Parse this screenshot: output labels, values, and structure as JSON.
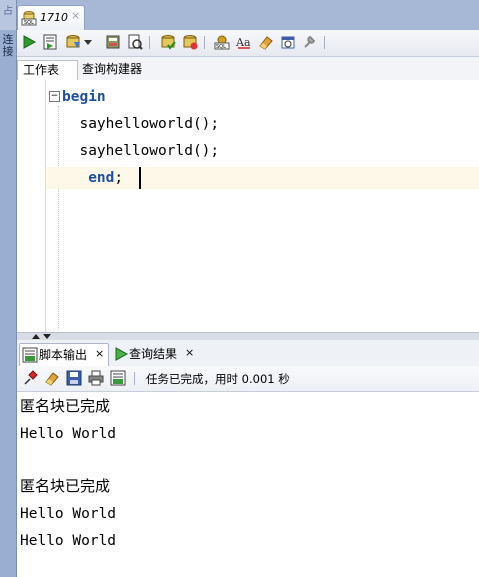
{
  "dock": {
    "top_label": "占",
    "vertical_label": "连接"
  },
  "editor_tab": {
    "title": "1710",
    "close": "×"
  },
  "sub_tabs": [
    {
      "label": "工作表"
    },
    {
      "label": "查询构建器"
    }
  ],
  "code": {
    "lines": [
      {
        "indent": "",
        "keyword": "begin",
        "text": ""
      },
      {
        "indent": "  ",
        "keyword": "",
        "text": "sayhelloworld();"
      },
      {
        "indent": "  ",
        "keyword": "",
        "text": "sayhelloworld();"
      },
      {
        "indent": "   ",
        "keyword": "end",
        "text": ";"
      }
    ]
  },
  "bottom_tabs": [
    {
      "label": "脚本输出",
      "close": "×"
    },
    {
      "label": "查询结果",
      "close": "×"
    }
  ],
  "status": {
    "text": "任务已完成，用时 0.001 秒"
  },
  "output": [
    {
      "text": "匿名块已完成",
      "mono": false
    },
    {
      "text": "Hello World",
      "mono": true
    },
    {
      "text": "",
      "mono": false
    },
    {
      "text": "匿名块已完成",
      "mono": false
    },
    {
      "text": "Hello World",
      "mono": true
    },
    {
      "text": "Hello World",
      "mono": true
    }
  ],
  "colors": {
    "keyword": "#1d4f9e",
    "current_line": "#fdf8e7",
    "tab_bar": "#a7b8d6"
  }
}
